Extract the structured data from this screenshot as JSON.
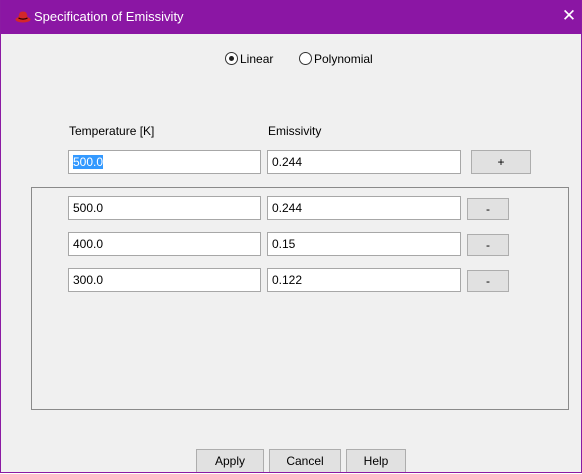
{
  "window": {
    "title": "Specification of Emissivity",
    "close_label": "✕"
  },
  "mode": {
    "options": [
      {
        "label": "Linear",
        "selected": true
      },
      {
        "label": "Polynomial",
        "selected": false
      }
    ]
  },
  "columns": {
    "temperature_label": "Temperature [K]",
    "emissivity_label": "Emissivity"
  },
  "entry": {
    "temperature": "500.0",
    "emissivity": "0.244",
    "add_label": "+"
  },
  "rows": [
    {
      "temperature": "500.0",
      "emissivity": "0.244",
      "remove_label": "-"
    },
    {
      "temperature": "400.0",
      "emissivity": "0.15",
      "remove_label": "-"
    },
    {
      "temperature": "300.0",
      "emissivity": "0.122",
      "remove_label": "-"
    }
  ],
  "scrollbar": {
    "up_icon": "chevron-up-icon",
    "down_icon": "chevron-down-icon"
  },
  "footer": {
    "apply_label": "Apply",
    "cancel_label": "Cancel",
    "help_label": "Help"
  },
  "colors": {
    "titlebar": "#8b16a4",
    "app_icon": "#d4272a",
    "selection": "#3399ff"
  }
}
